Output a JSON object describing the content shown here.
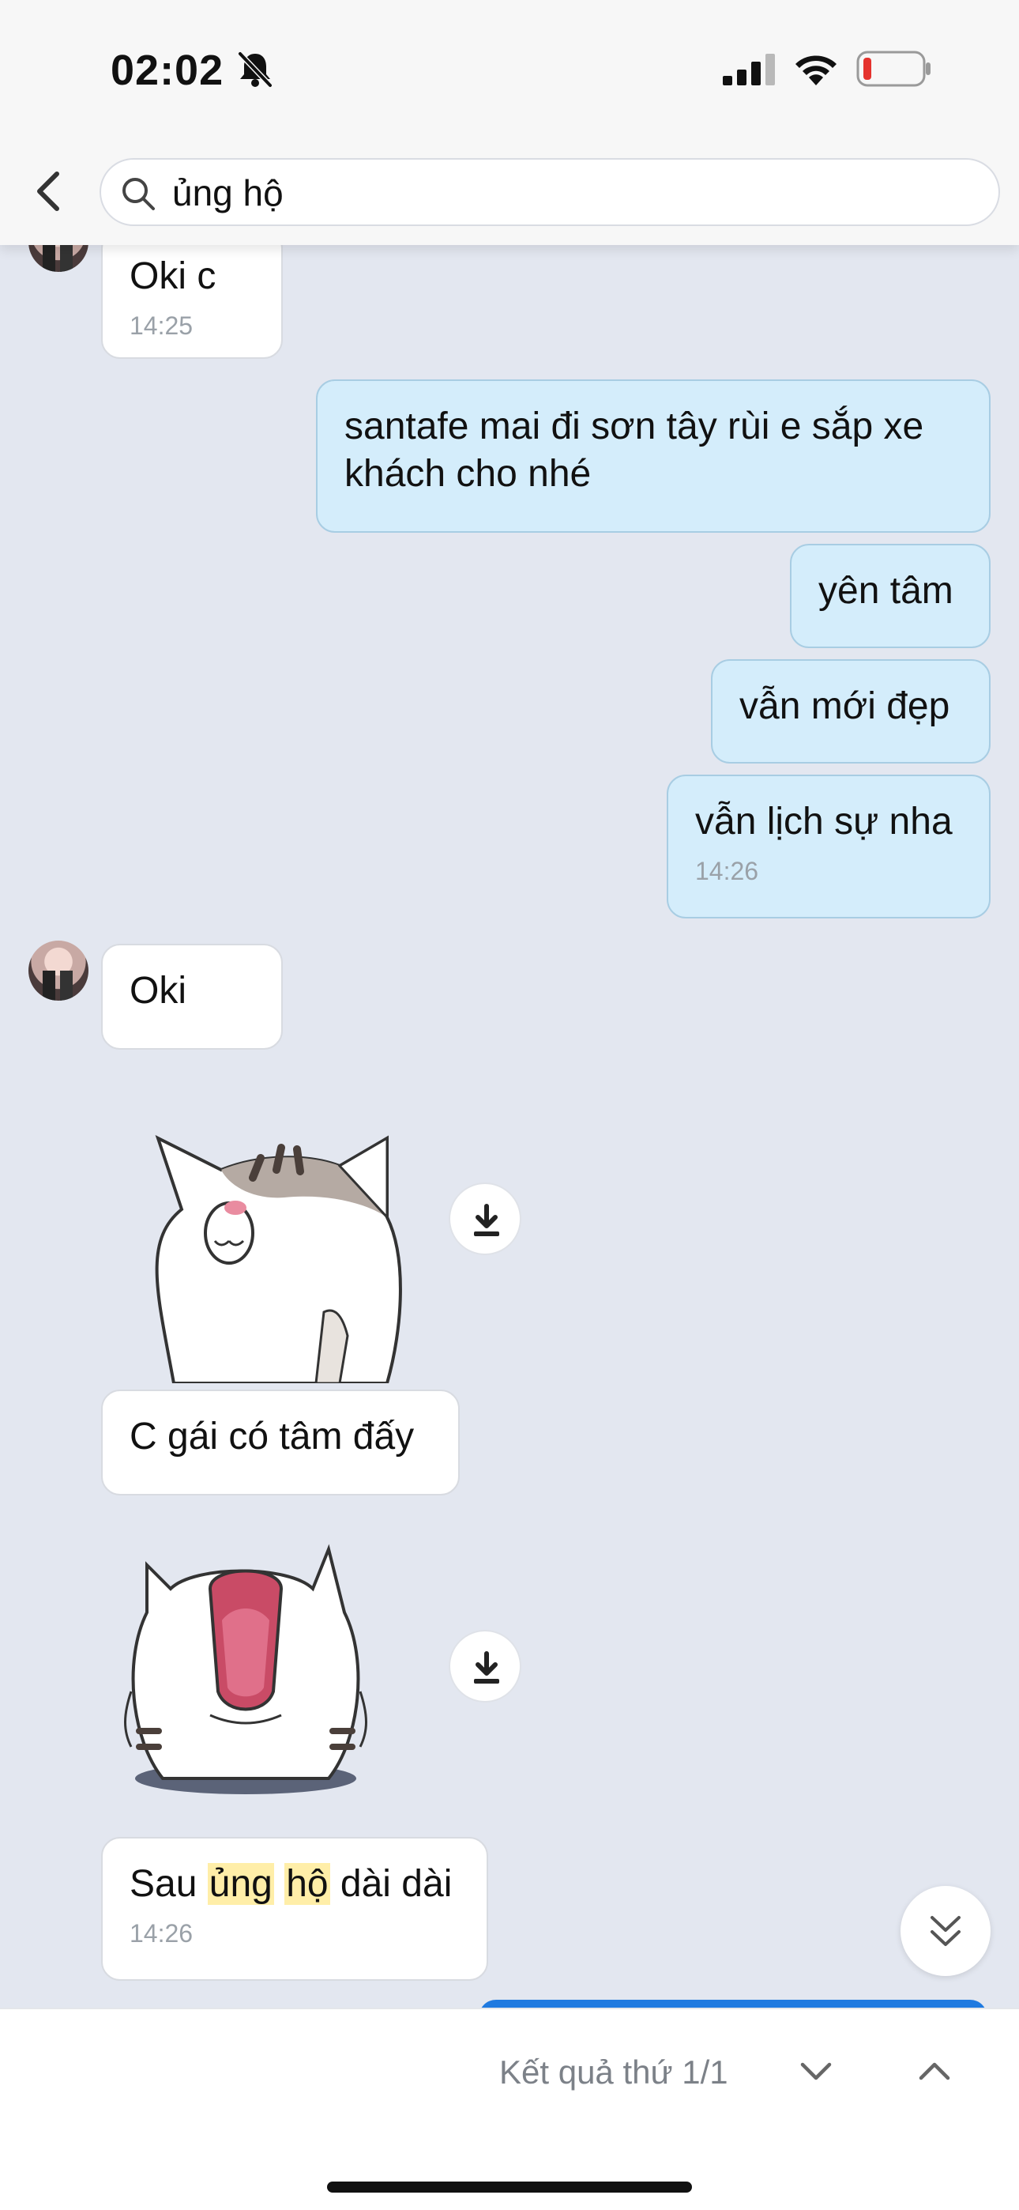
{
  "status_bar": {
    "time": "02:02"
  },
  "search": {
    "query": "ủng hộ"
  },
  "messages": [
    {
      "type": "in",
      "text": "Oki c",
      "time": "14:25"
    },
    {
      "type": "out",
      "line1": "santafe mai đi sơn tây rùi e sắp xe",
      "line2": "khách cho nhé"
    },
    {
      "type": "out",
      "text": "yên tâm"
    },
    {
      "type": "out",
      "text": "vẫn mới đẹp"
    },
    {
      "type": "out",
      "text": "vẫn lịch sự nha",
      "time": "14:26"
    },
    {
      "type": "in",
      "text": "Oki"
    },
    {
      "type": "in",
      "text": "C gái có tâm đấy"
    },
    {
      "type": "in",
      "before": "Sau ",
      "match1": "ủng",
      "space": " ",
      "match2": "hộ",
      "after": " dài dài",
      "time": "14:26"
    }
  ],
  "search_results": {
    "label": "Kết quả thứ 1/1"
  },
  "colors": {
    "incoming": "#ffffff",
    "outgoing": "#d4edfb",
    "highlight": "#ffeea8",
    "background": "#e3e7f0"
  },
  "icons": [
    "bell-off-icon",
    "signal-icon",
    "wifi-icon",
    "battery-icon",
    "back-icon",
    "search-icon",
    "download-icon",
    "double-chevron-down-icon",
    "chevron-down-icon",
    "chevron-up-icon"
  ]
}
